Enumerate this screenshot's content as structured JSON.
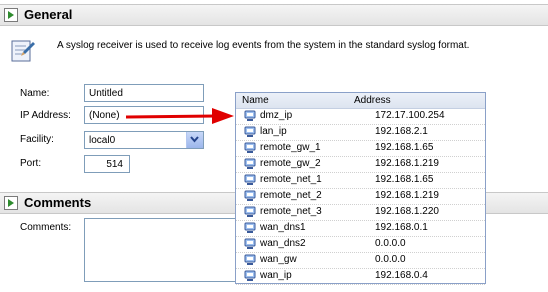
{
  "general": {
    "title": "General",
    "info_text": "A syslog receiver is used to receive log events from the system in the standard syslog format."
  },
  "form": {
    "name_label": "Name:",
    "name_value": "Untitled",
    "ip_label": "IP Address:",
    "ip_value": "(None)",
    "facility_label": "Facility:",
    "facility_value": "local0",
    "port_label": "Port:",
    "port_value": "514"
  },
  "comments": {
    "title": "Comments",
    "label": "Comments:",
    "value": ""
  },
  "address_dropdown": {
    "col_name": "Name",
    "col_address": "Address",
    "rows": [
      {
        "name": "dmz_ip",
        "address": "172.17.100.254"
      },
      {
        "name": "lan_ip",
        "address": "192.168.2.1"
      },
      {
        "name": "remote_gw_1",
        "address": "192.168.1.65"
      },
      {
        "name": "remote_gw_2",
        "address": "192.168.1.219"
      },
      {
        "name": "remote_net_1",
        "address": "192.168.1.65"
      },
      {
        "name": "remote_net_2",
        "address": "192.168.1.219"
      },
      {
        "name": "remote_net_3",
        "address": "192.168.1.220"
      },
      {
        "name": "wan_dns1",
        "address": "192.168.0.1"
      },
      {
        "name": "wan_dns2",
        "address": "0.0.0.0"
      },
      {
        "name": "wan_gw",
        "address": "0.0.0.0"
      },
      {
        "name": "wan_ip",
        "address": "192.168.0.4"
      }
    ]
  },
  "colors": {
    "header_bg": "#e8e8e8",
    "input_border": "#7f9db9",
    "annotation_arrow": "#e00000"
  }
}
